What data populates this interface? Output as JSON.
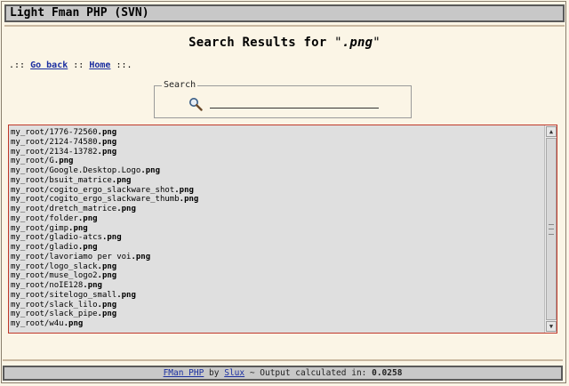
{
  "app": {
    "title": "Light Fman PHP (SVN)"
  },
  "heading": {
    "prefix": "Search Results for ",
    "open_quote": "\"",
    "term": ".png",
    "close_quote": "\""
  },
  "nav": {
    "lead": ".:: ",
    "go_back": "Go back",
    "sep": " :: ",
    "home": "Home",
    "tail": " ::."
  },
  "search": {
    "legend": "Search",
    "icon": "magnifier-icon",
    "value": "",
    "placeholder": ""
  },
  "results": [
    {
      "prefix": "my_root/1776-72560",
      "ext": ".png"
    },
    {
      "prefix": "my_root/2124-74580",
      "ext": ".png"
    },
    {
      "prefix": "my_root/2134-13782",
      "ext": ".png"
    },
    {
      "prefix": "my_root/G",
      "ext": ".png"
    },
    {
      "prefix": "my_root/Google.Desktop.Logo",
      "ext": ".png"
    },
    {
      "prefix": "my_root/bsuit_matrice",
      "ext": ".png"
    },
    {
      "prefix": "my_root/cogito_ergo_slackware_shot",
      "ext": ".png"
    },
    {
      "prefix": "my_root/cogito_ergo_slackware_thumb",
      "ext": ".png"
    },
    {
      "prefix": "my_root/dretch_matrice",
      "ext": ".png"
    },
    {
      "prefix": "my_root/folder",
      "ext": ".png"
    },
    {
      "prefix": "my_root/gimp",
      "ext": ".png"
    },
    {
      "prefix": "my_root/gladio-atcs",
      "ext": ".png"
    },
    {
      "prefix": "my_root/gladio",
      "ext": ".png"
    },
    {
      "prefix": "my_root/lavoriamo per voi",
      "ext": ".png"
    },
    {
      "prefix": "my_root/logo_slack",
      "ext": ".png"
    },
    {
      "prefix": "my_root/muse_logo2",
      "ext": ".png"
    },
    {
      "prefix": "my_root/noIE128",
      "ext": ".png"
    },
    {
      "prefix": "my_root/sitelogo_small",
      "ext": ".png"
    },
    {
      "prefix": "my_root/slack_lilo",
      "ext": ".png"
    },
    {
      "prefix": "my_root/slack_pipe",
      "ext": ".png"
    },
    {
      "prefix": "my_root/w4u",
      "ext": ".png"
    }
  ],
  "scrollbar": {
    "up_glyph": "▲",
    "down_glyph": "▼"
  },
  "footer": {
    "fman_link": "FMan PHP",
    "by": " by ",
    "author_link": "Slux",
    "middle": " ~ Output calculated in: ",
    "time": "0.0258"
  },
  "colors": {
    "background": "#fbf5e6",
    "bar": "#c8c8c8",
    "results_border": "#c0392b",
    "link": "#1a2ea0"
  }
}
